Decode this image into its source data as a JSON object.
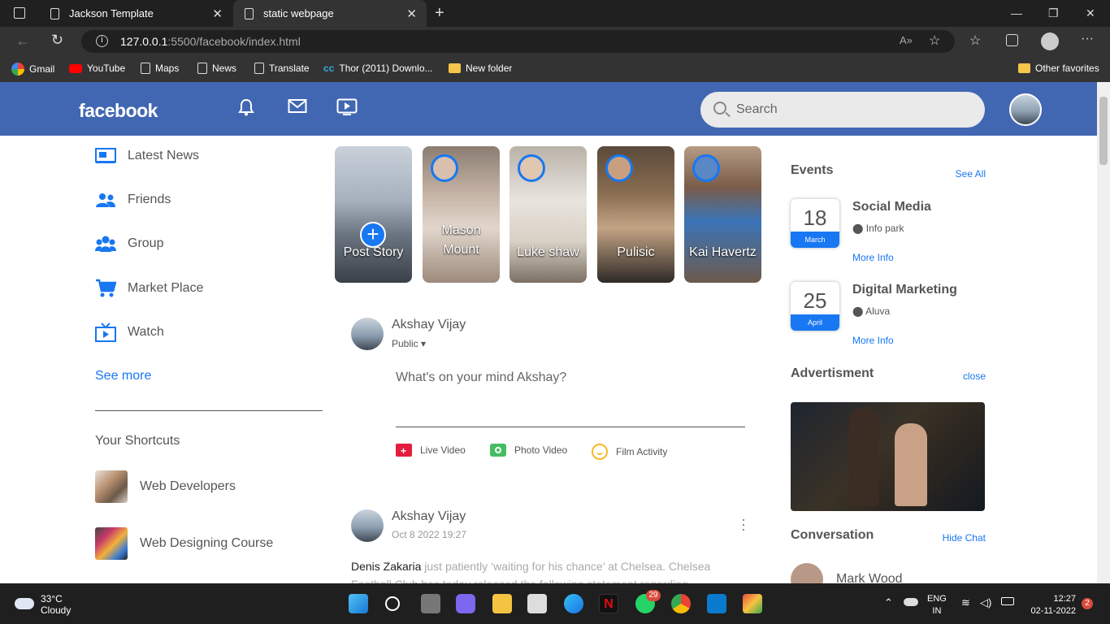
{
  "browser": {
    "tabs": [
      {
        "label": "Jackson Template",
        "active": false
      },
      {
        "label": "static webpage",
        "active": true
      }
    ],
    "url_host": "127.0.0.1",
    "url_path": ":5500/facebook/index.html",
    "bookmarks": [
      "Gmail",
      "YouTube",
      "Maps",
      "News",
      "Translate",
      "Thor (2011) Downlo...",
      "New folder"
    ],
    "other_favorites": "Other favorites"
  },
  "header": {
    "logo": "facebook",
    "search_placeholder": "Search",
    "icons": [
      "bell-icon",
      "mail-icon",
      "video-icon"
    ]
  },
  "sidebar": {
    "items": [
      {
        "label": "Latest News",
        "icon": "news-icon"
      },
      {
        "label": "Friends",
        "icon": "friends-icon"
      },
      {
        "label": "Group",
        "icon": "group-icon"
      },
      {
        "label": "Market Place",
        "icon": "cart-icon"
      },
      {
        "label": "Watch",
        "icon": "tv-icon"
      }
    ],
    "see_more": "See more",
    "shortcuts_title": "Your Shortcuts",
    "shortcuts": [
      "Web Developers",
      "Web Designing Course"
    ]
  },
  "stories": [
    {
      "name": "Post Story"
    },
    {
      "name": "Mason Mount"
    },
    {
      "name": "Luke shaw"
    },
    {
      "name": "Pulisic"
    },
    {
      "name": "Kai Havertz"
    }
  ],
  "composer": {
    "user": "Akshay Vijay",
    "visibility": "Public",
    "placeholder": "What's on your mind Akshay?",
    "actions": [
      "Live Video",
      "Photo Video",
      "Film Activity"
    ]
  },
  "post": {
    "user": "Akshay Vijay",
    "time": "Oct 8 2022 19:27",
    "mention": "Denis Zakaria",
    "text": " just patiently ‘waiting for his chance’ at Chelsea. Chelsea Football Club has today released the following statement regarding"
  },
  "events": {
    "title": "Events",
    "see_all": "See All",
    "items": [
      {
        "day": "18",
        "month": "March",
        "title": "Social Media",
        "location": "Info park",
        "more": "More Info"
      },
      {
        "day": "25",
        "month": "April",
        "title": "Digital Marketing",
        "location": "Aluva",
        "more": "More Info"
      }
    ]
  },
  "advertisement": {
    "title": "Advertisment",
    "close": "close"
  },
  "conversation": {
    "title": "Conversation",
    "hide": "Hide Chat",
    "contact": "Mark Wood"
  },
  "taskbar": {
    "temp": "33°C",
    "condition": "Cloudy",
    "whatsapp_badge": "29",
    "lang": "ENG",
    "region": "IN",
    "time": "12:27",
    "date": "02-11-2022",
    "notif": "2"
  }
}
